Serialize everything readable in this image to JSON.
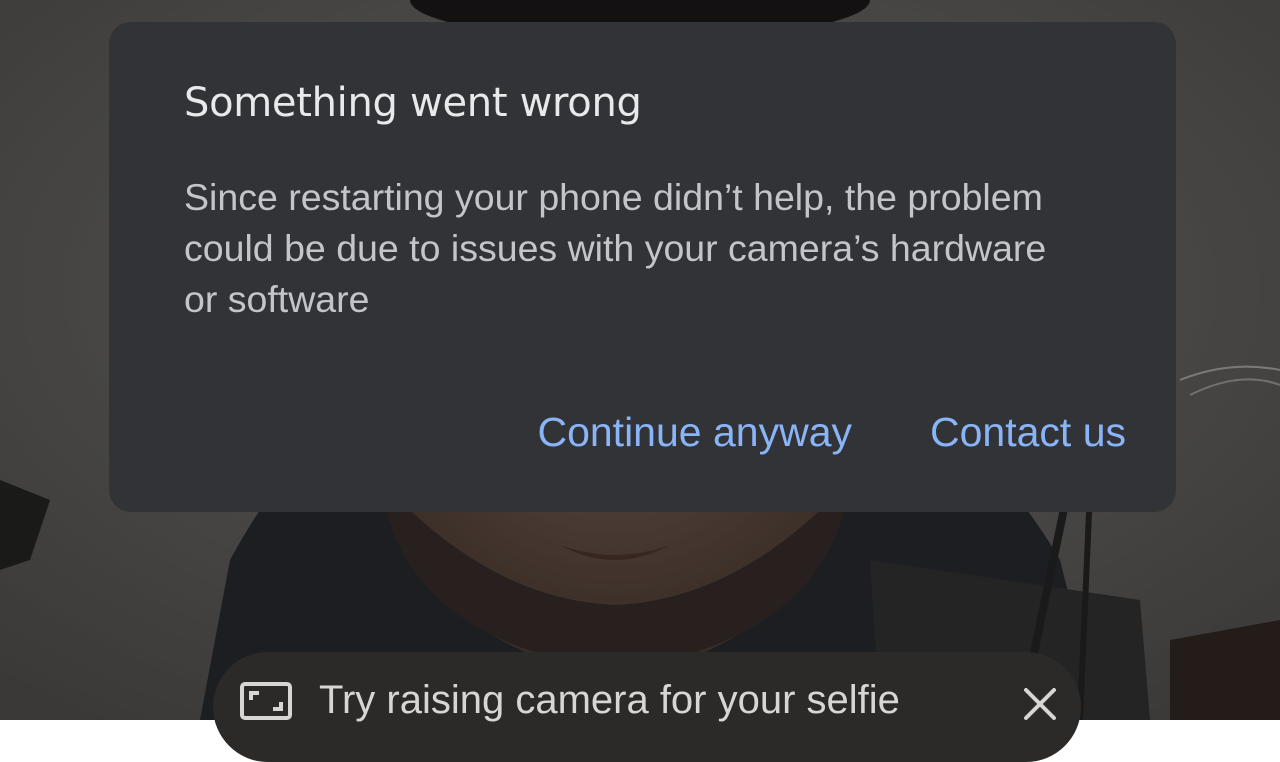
{
  "dialog": {
    "title": "Something went wrong",
    "body": "Since restarting your phone didn’t help, the problem could be due to issues with your camera’s hardware or software",
    "actions": {
      "continue_label": "Continue anyway",
      "contact_label": "Contact us"
    }
  },
  "tip": {
    "text": "Try raising camera for your selfie",
    "icon": "frame-corners-icon",
    "close_icon": "close-icon"
  },
  "colors": {
    "dialog_background": "#323336",
    "title": "#e8e9eb",
    "body": "#c2c5ca",
    "accent": "#8ab4f8"
  }
}
